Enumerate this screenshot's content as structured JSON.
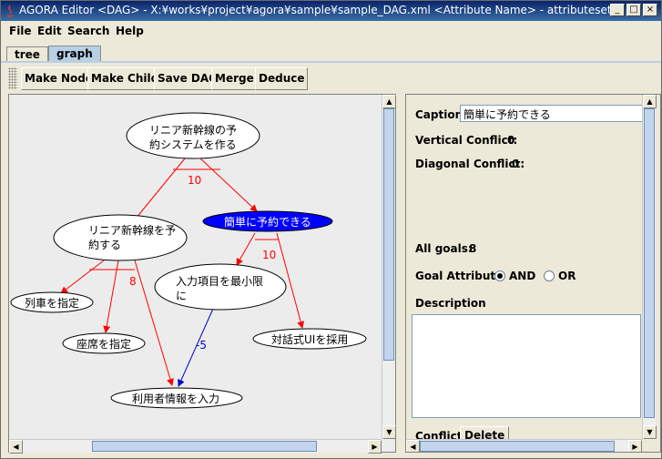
{
  "window": {
    "title": "AGORA Editor <DAG> - X:¥works¥project¥agora¥sample¥sample_DAG.xml <Attribute Name> - attributeset",
    "controls": [
      "_",
      "□",
      "×"
    ]
  },
  "menubar": {
    "file": "File",
    "edit": "Edit",
    "search": "Search",
    "help": "Help"
  },
  "tabs": {
    "tree": "tree",
    "graph": "graph"
  },
  "toolbar": {
    "make_node": "Make Node",
    "make_child": "Make Child",
    "save_dag": "Save DAG",
    "merge": "Merge",
    "deduce": "Deduce"
  },
  "graph": {
    "nodes": [
      {
        "line1": "リニア新幹線の予",
        "line2": "約システムを作る"
      },
      {
        "line1": "簡単に予約できる",
        "line2": ""
      },
      {
        "line1": "リニア新幹線を予",
        "line2": "約する"
      },
      {
        "line1": "入力項目を最小限",
        "line2": "に"
      },
      {
        "line1": "列車を指定",
        "line2": ""
      },
      {
        "line1": "座席を指定",
        "line2": ""
      },
      {
        "line1": "対話式UIを採用",
        "line2": ""
      },
      {
        "line1": "利用者情報を入力",
        "line2": ""
      }
    ],
    "edge_labels": [
      "10",
      "10",
      "8",
      "-5"
    ],
    "colors": {
      "and_edge": "#ff0000",
      "neg_edge": "#0000cc",
      "selected_node": "#0000ff"
    }
  },
  "detail": {
    "caption_label": "Caption",
    "caption_value": "簡単に予約できる",
    "vertical_conflict_label": "Vertical Conflict:",
    "vertical_conflict_value": "0",
    "diagonal_conflict_label": "Diagonal Conflict:",
    "diagonal_conflict_value": "0",
    "all_goals_label": "All goals:",
    "all_goals_value": "8",
    "goal_attribute_label": "Goal Attribute",
    "and_label": "AND",
    "or_label": "OR",
    "description_label": "Description",
    "conflict_label": "Conflict",
    "delete_label": "Delete"
  }
}
